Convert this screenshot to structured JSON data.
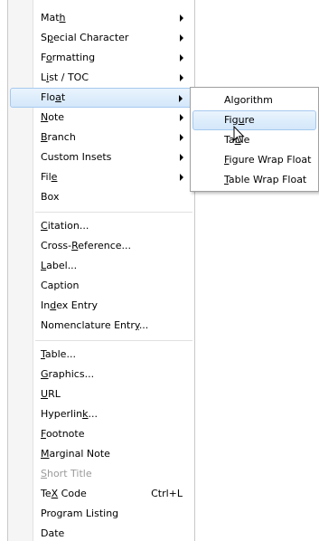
{
  "menu": {
    "items": [
      {
        "pre": "Mat",
        "acc": "h",
        "post": "",
        "submenu": true
      },
      {
        "pre": "S",
        "acc": "p",
        "post": "ecial Character",
        "submenu": true
      },
      {
        "pre": "F",
        "acc": "o",
        "post": "rmatting",
        "submenu": true
      },
      {
        "pre": "L",
        "acc": "i",
        "post": "st / TOC",
        "submenu": true
      },
      {
        "pre": "Flo",
        "acc": "a",
        "post": "t",
        "submenu": true,
        "active": true
      },
      {
        "pre": "",
        "acc": "N",
        "post": "ote",
        "submenu": true
      },
      {
        "pre": "",
        "acc": "B",
        "post": "ranch",
        "submenu": true
      },
      {
        "pre": "Custom Insets",
        "acc": "",
        "post": "",
        "submenu": true
      },
      {
        "pre": "Fil",
        "acc": "e",
        "post": "",
        "submenu": true
      },
      {
        "pre": "Box",
        "acc": "",
        "post": ""
      },
      {
        "pre": "",
        "acc": "C",
        "post": "itation...",
        "sepBefore": true
      },
      {
        "pre": "Cross-",
        "acc": "R",
        "post": "eference..."
      },
      {
        "pre": "",
        "acc": "L",
        "post": "abel..."
      },
      {
        "pre": "Caption",
        "acc": "",
        "post": ""
      },
      {
        "pre": "In",
        "acc": "d",
        "post": "ex Entry"
      },
      {
        "pre": "Nomenclature Entr",
        "acc": "y",
        "post": "..."
      },
      {
        "pre": "",
        "acc": "T",
        "post": "able...",
        "sepBefore": true
      },
      {
        "pre": "",
        "acc": "G",
        "post": "raphics..."
      },
      {
        "pre": "",
        "acc": "U",
        "post": "RL"
      },
      {
        "pre": "Hyperlin",
        "acc": "k",
        "post": "..."
      },
      {
        "pre": "",
        "acc": "F",
        "post": "ootnote"
      },
      {
        "pre": "",
        "acc": "M",
        "post": "arginal Note"
      },
      {
        "pre": "",
        "acc": "S",
        "post": "hort Title",
        "disabled": true
      },
      {
        "pre": "Te",
        "acc": "X",
        "post": " Code",
        "shortcut": "Ctrl+L"
      },
      {
        "pre": "Program Listing",
        "acc": "",
        "post": ""
      },
      {
        "pre": "Date",
        "acc": "",
        "post": ""
      }
    ]
  },
  "submenu": {
    "items": [
      {
        "pre": "Algorithm",
        "acc": "",
        "post": ""
      },
      {
        "pre": "Fig",
        "acc": "u",
        "post": "re",
        "active": true
      },
      {
        "pre": "Ta",
        "acc": "b",
        "post": "le"
      },
      {
        "pre": "",
        "acc": "F",
        "post": "igure Wrap Float"
      },
      {
        "pre": "",
        "acc": "T",
        "post": "able Wrap Float"
      }
    ]
  }
}
